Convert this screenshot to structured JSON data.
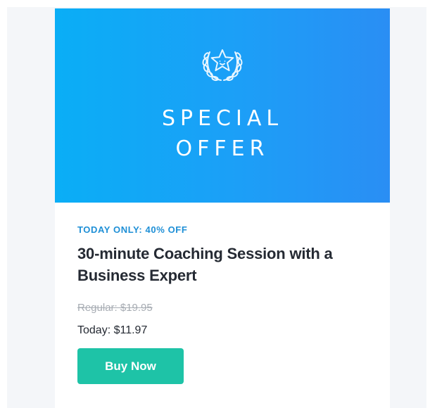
{
  "hero": {
    "icon": "star-laurel-icon",
    "title_line1": "SPECIAL",
    "title_line2": "OFFER",
    "gradient_start": "#0aaef6",
    "gradient_end": "#2a8ef4"
  },
  "offer": {
    "kicker": "TODAY ONLY: 40% OFF",
    "title": "30-minute Coaching Session with a Business Expert",
    "regular_price": "Regular: $19.95",
    "today_price": "Today: $11.97",
    "button_label": "Buy Now",
    "button_color": "#1ec3a7",
    "kicker_color": "#1e8fd6"
  }
}
